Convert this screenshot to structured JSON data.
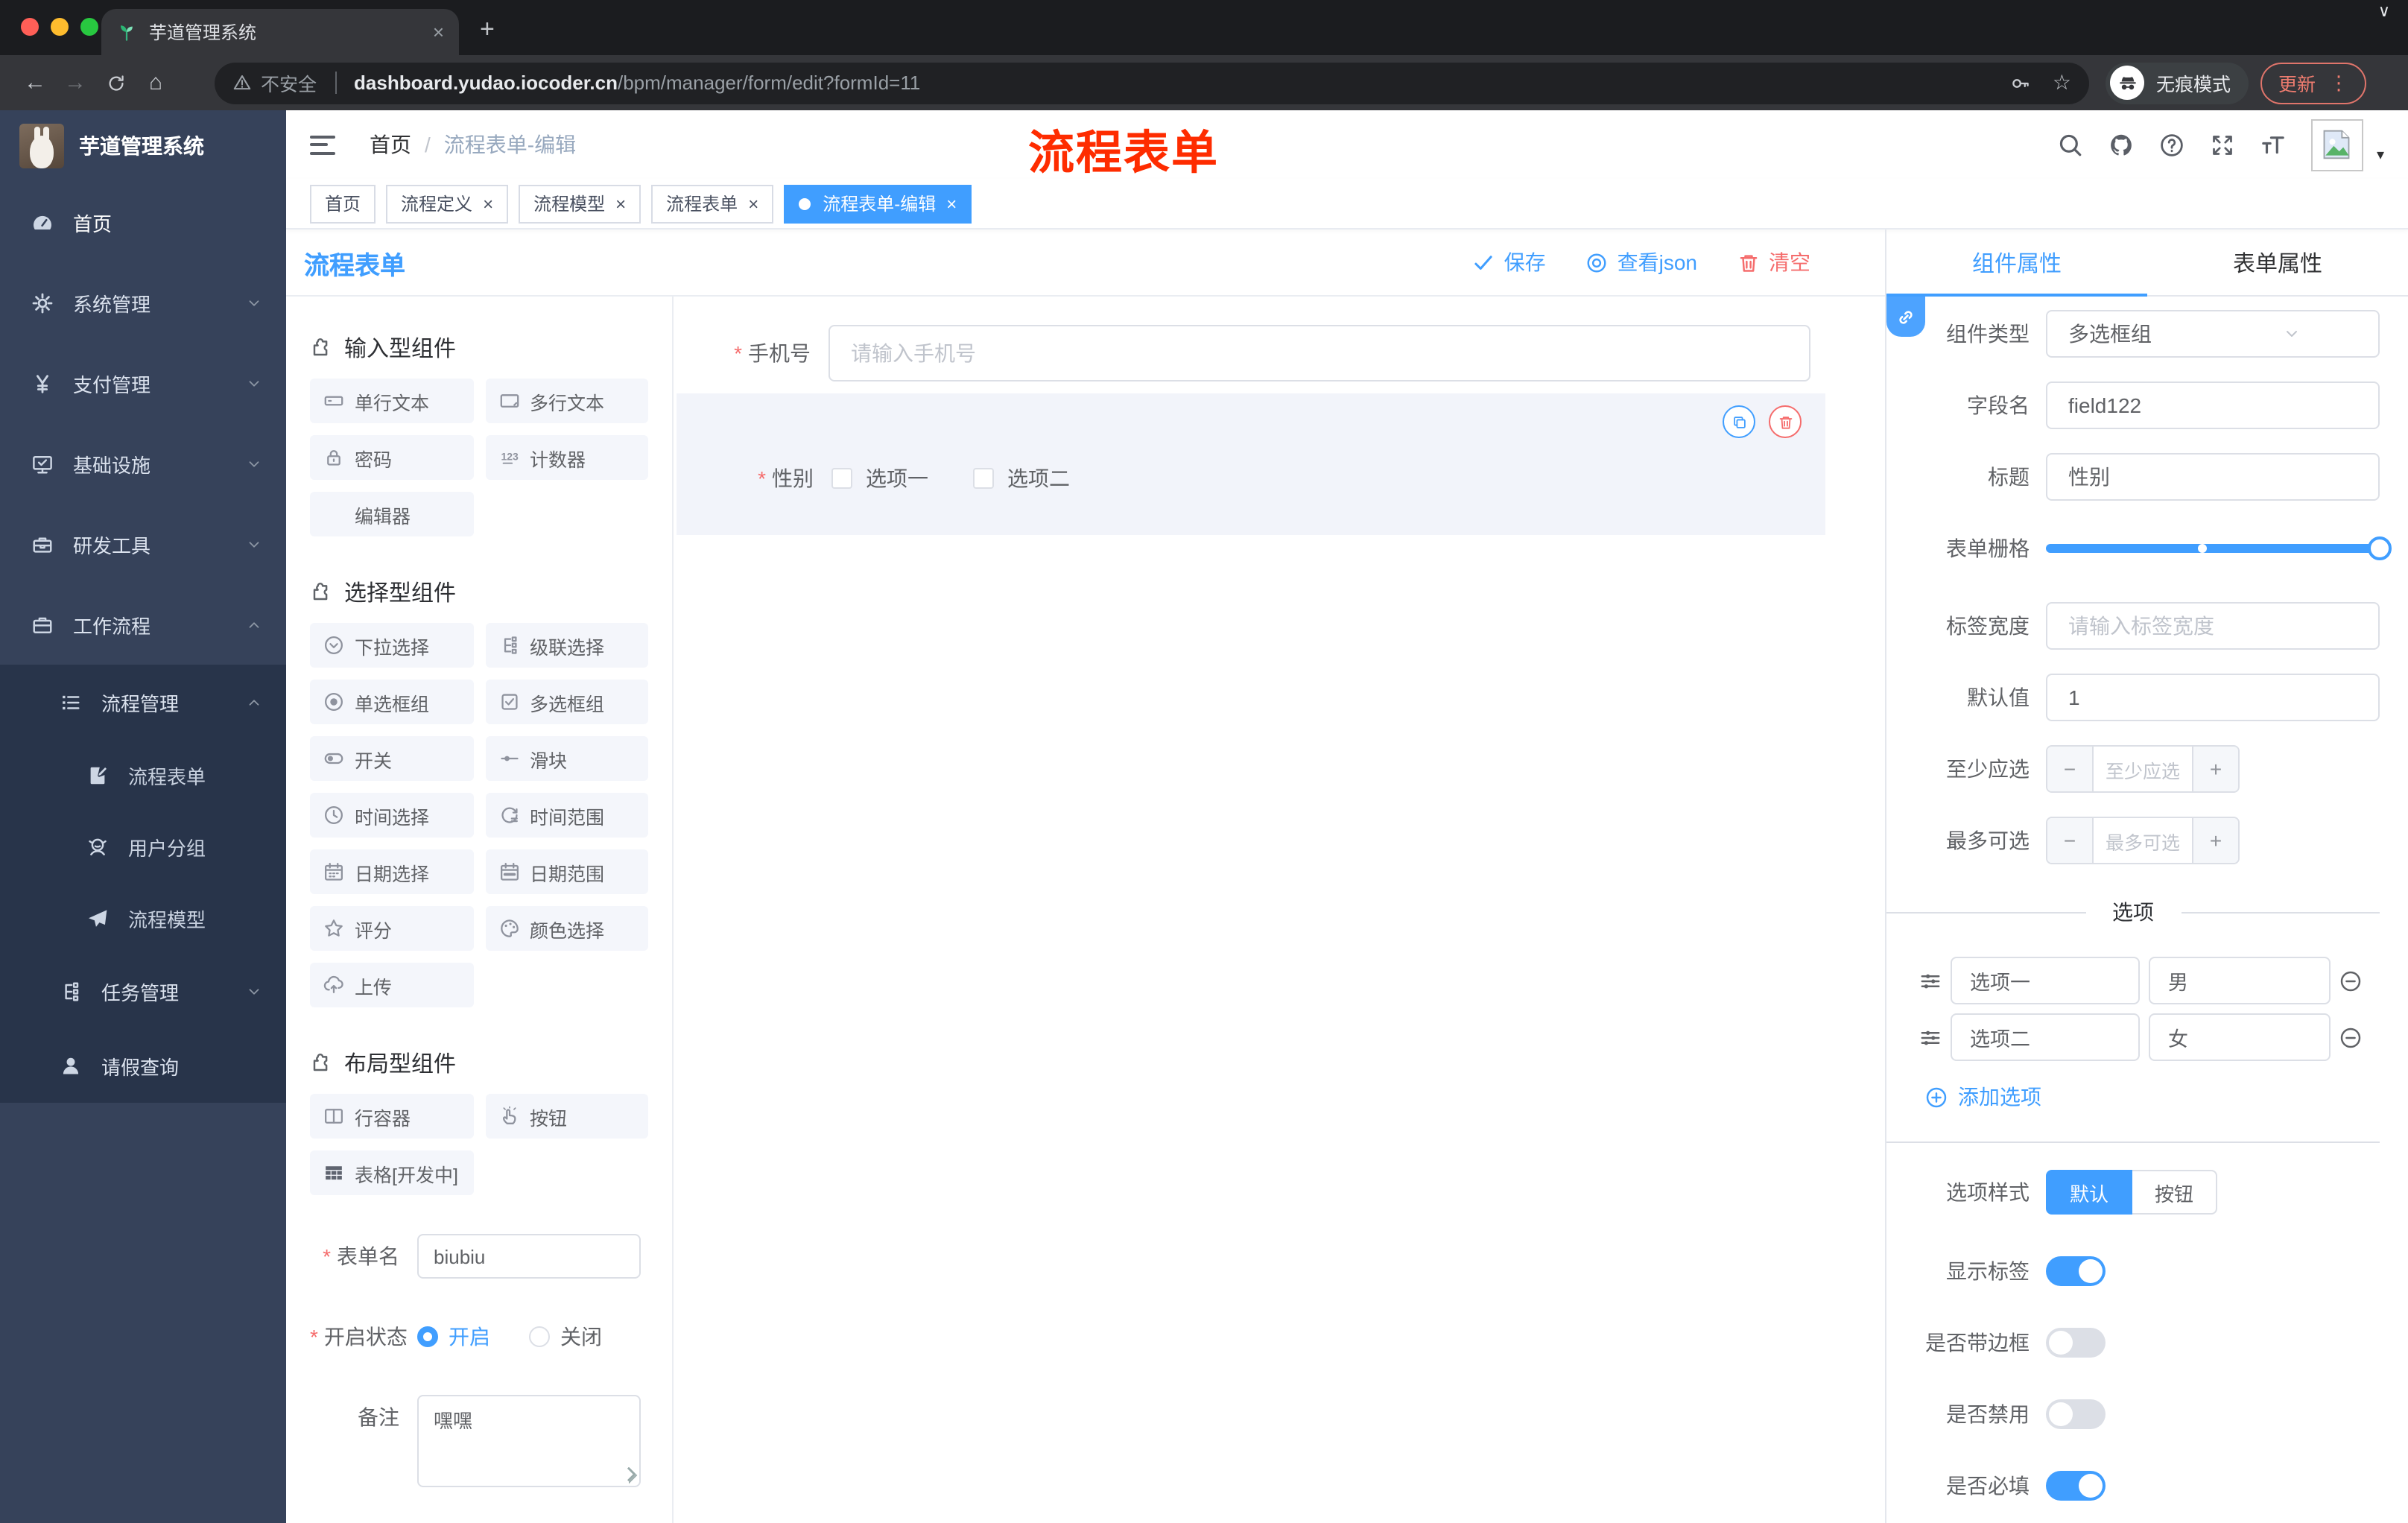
{
  "theme": {
    "primary": "#409eff",
    "danger": "#f56c6c",
    "sidebar_bg": "#36425a",
    "submenu_bg": "#28344a",
    "tag_active": "#409eff",
    "annotation_red": "#fe2c00",
    "chrome_dark": "#1b1c1f",
    "chrome_toolbar": "#35363a"
  },
  "browser": {
    "tab_title": "芋道管理系统",
    "tab_favicon": "sprout-icon",
    "security_label": "不安全",
    "url_domain": "dashboard.yudao.iocoder.cn",
    "url_path": "/bpm/manager/form/edit?formId=11",
    "incognito_label": "无痕模式",
    "update_button": "更新"
  },
  "sidebar": {
    "logo_title": "芋道管理系统",
    "menu": [
      {
        "label": "首页",
        "icon": "dashboard-icon",
        "expandable": false
      },
      {
        "label": "系统管理",
        "icon": "gear-icon",
        "expandable": true
      },
      {
        "label": "支付管理",
        "icon": "yen-icon",
        "expandable": true
      },
      {
        "label": "基础设施",
        "icon": "monitor-icon",
        "expandable": true
      },
      {
        "label": "研发工具",
        "icon": "toolbox-icon",
        "expandable": true
      },
      {
        "label": "工作流程",
        "icon": "briefcase-icon",
        "expandable": true,
        "expanded": true
      }
    ],
    "submenu": [
      {
        "label": "流程管理",
        "icon": "flow-list-icon",
        "expanded": true
      },
      {
        "label": "流程表单",
        "icon": "form-edit-icon",
        "child": true
      },
      {
        "label": "用户分组",
        "icon": "user-group-icon",
        "child": true
      },
      {
        "label": "流程模型",
        "icon": "paper-plane-icon",
        "child": true
      },
      {
        "label": "任务管理",
        "icon": "tree-icon"
      },
      {
        "label": "请假查询",
        "icon": "person-icon"
      }
    ]
  },
  "navbar": {
    "breadcrumb": [
      "首页",
      "流程表单-编辑"
    ],
    "separator": "/",
    "annotation": "流程表单"
  },
  "tags": [
    {
      "label": "首页",
      "closable": false,
      "active": false
    },
    {
      "label": "流程定义",
      "closable": true,
      "active": false
    },
    {
      "label": "流程模型",
      "closable": true,
      "active": false
    },
    {
      "label": "流程表单",
      "closable": true,
      "active": false
    },
    {
      "label": "流程表单-编辑",
      "closable": true,
      "active": true
    }
  ],
  "designer": {
    "title": "流程表单",
    "actions": {
      "save": "保存",
      "view_json": "查看json",
      "clear": "清空"
    },
    "sections": {
      "input": {
        "title": "输入型组件",
        "icon": "puzzle-icon",
        "items": [
          {
            "label": "单行文本",
            "icon": "single-line"
          },
          {
            "label": "多行文本",
            "icon": "multi-line"
          },
          {
            "label": "密码",
            "icon": "lock"
          },
          {
            "label": "计数器",
            "icon": "counter"
          },
          {
            "label": "编辑器",
            "icon": ""
          }
        ]
      },
      "select": {
        "title": "选择型组件",
        "icon": "puzzle-icon",
        "items": [
          {
            "label": "下拉选择",
            "icon": "select"
          },
          {
            "label": "级联选择",
            "icon": "cascade"
          },
          {
            "label": "单选框组",
            "icon": "radio"
          },
          {
            "label": "多选框组",
            "icon": "checkbox"
          },
          {
            "label": "开关",
            "icon": "switch"
          },
          {
            "label": "滑块",
            "icon": "slider"
          },
          {
            "label": "时间选择",
            "icon": "clock"
          },
          {
            "label": "时间范围",
            "icon": "time-range"
          },
          {
            "label": "日期选择",
            "icon": "calendar"
          },
          {
            "label": "日期范围",
            "icon": "date-range"
          },
          {
            "label": "评分",
            "icon": "star"
          },
          {
            "label": "颜色选择",
            "icon": "palette"
          },
          {
            "label": "上传",
            "icon": "upload"
          }
        ]
      },
      "layout": {
        "title": "布局型组件",
        "icon": "puzzle-icon",
        "items": [
          {
            "label": "行容器",
            "icon": "row-container"
          },
          {
            "label": "按钮",
            "icon": "button-hand"
          },
          {
            "label": "表格[开发中]",
            "icon": "table"
          }
        ]
      }
    },
    "meta_form": {
      "name_label": "表单名",
      "name_value": "biubiu",
      "status_label": "开启状态",
      "status_options": [
        {
          "label": "开启",
          "checked": true
        },
        {
          "label": "关闭",
          "checked": false
        }
      ],
      "remark_label": "备注",
      "remark_value": "嘿嘿"
    },
    "canvas": {
      "phone_field": {
        "label": "手机号",
        "required": true,
        "placeholder": "请输入手机号"
      },
      "gender_field": {
        "label": "性别",
        "required": true,
        "options": [
          "选项一",
          "选项二"
        ]
      }
    }
  },
  "props_panel": {
    "tabs": [
      {
        "label": "组件属性",
        "active": true
      },
      {
        "label": "表单属性",
        "active": false
      }
    ],
    "component_type": {
      "label": "组件类型",
      "value": "多选框组"
    },
    "field_name": {
      "label": "字段名",
      "value": "field122"
    },
    "title_row": {
      "label": "标题",
      "value": "性别"
    },
    "form_grid": {
      "label": "表单栅格",
      "value_percent": 100,
      "stop_percent": 47
    },
    "label_width": {
      "label": "标签宽度",
      "placeholder": "请输入标签宽度"
    },
    "default_value": {
      "label": "默认值",
      "value": "1"
    },
    "min_select": {
      "label": "至少应选",
      "placeholder": "至少应选",
      "minus": "−",
      "plus": "+"
    },
    "max_select": {
      "label": "最多可选",
      "placeholder": "最多可选",
      "minus": "−",
      "plus": "+"
    },
    "options_divider": "选项",
    "options": [
      {
        "label": "选项一",
        "value": "男"
      },
      {
        "label": "选项二",
        "value": "女"
      }
    ],
    "add_option": "添加选项",
    "option_style": {
      "label": "选项样式",
      "options": [
        {
          "label": "默认",
          "active": true
        },
        {
          "label": "按钮",
          "active": false
        }
      ]
    },
    "toggles": [
      {
        "label": "显示标签",
        "on": true
      },
      {
        "label": "是否带边框",
        "on": false
      },
      {
        "label": "是否禁用",
        "on": false
      },
      {
        "label": "是否必填",
        "on": true
      }
    ]
  }
}
